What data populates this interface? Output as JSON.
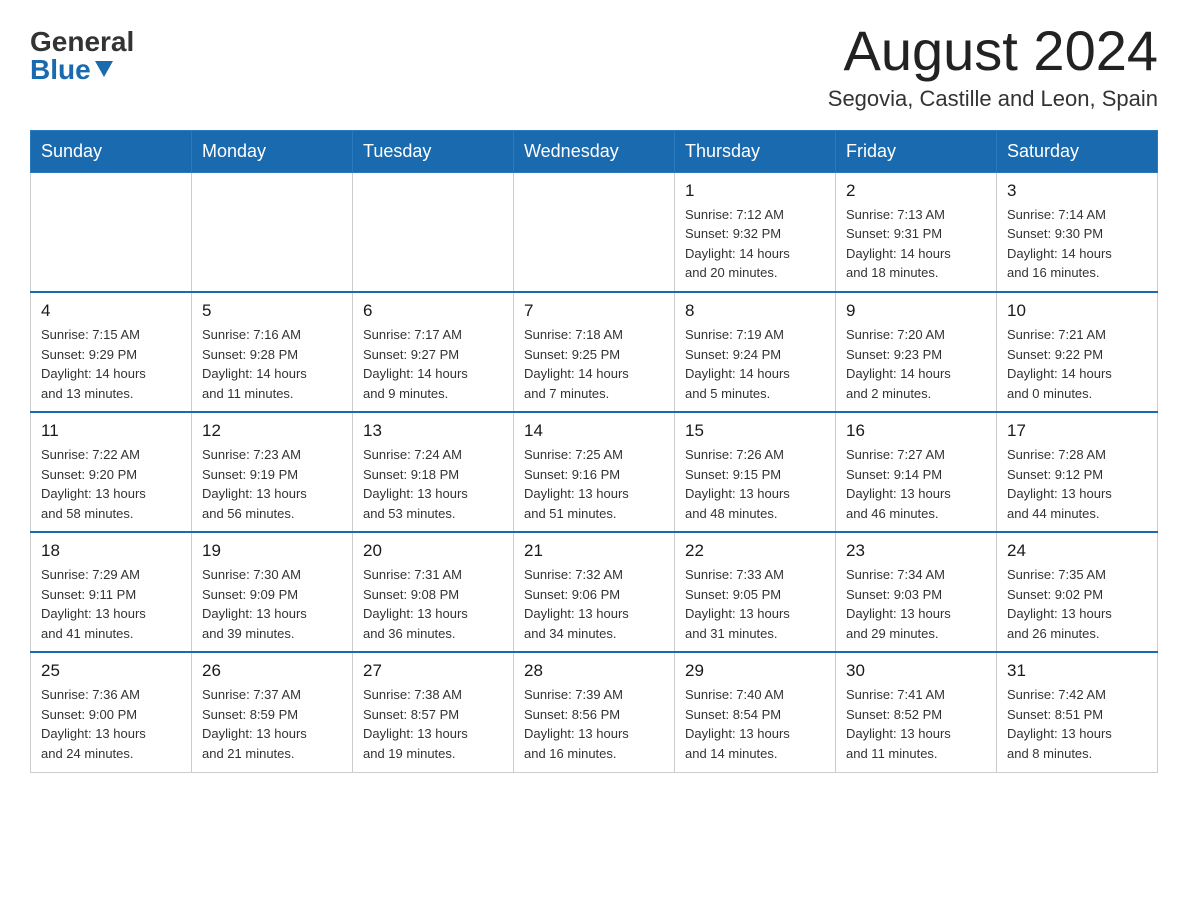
{
  "logo": {
    "general": "General",
    "blue": "Blue"
  },
  "title": {
    "month": "August 2024",
    "location": "Segovia, Castille and Leon, Spain"
  },
  "weekdays": [
    "Sunday",
    "Monday",
    "Tuesday",
    "Wednesday",
    "Thursday",
    "Friday",
    "Saturday"
  ],
  "weeks": [
    [
      {
        "day": "",
        "info": ""
      },
      {
        "day": "",
        "info": ""
      },
      {
        "day": "",
        "info": ""
      },
      {
        "day": "",
        "info": ""
      },
      {
        "day": "1",
        "info": "Sunrise: 7:12 AM\nSunset: 9:32 PM\nDaylight: 14 hours\nand 20 minutes."
      },
      {
        "day": "2",
        "info": "Sunrise: 7:13 AM\nSunset: 9:31 PM\nDaylight: 14 hours\nand 18 minutes."
      },
      {
        "day": "3",
        "info": "Sunrise: 7:14 AM\nSunset: 9:30 PM\nDaylight: 14 hours\nand 16 minutes."
      }
    ],
    [
      {
        "day": "4",
        "info": "Sunrise: 7:15 AM\nSunset: 9:29 PM\nDaylight: 14 hours\nand 13 minutes."
      },
      {
        "day": "5",
        "info": "Sunrise: 7:16 AM\nSunset: 9:28 PM\nDaylight: 14 hours\nand 11 minutes."
      },
      {
        "day": "6",
        "info": "Sunrise: 7:17 AM\nSunset: 9:27 PM\nDaylight: 14 hours\nand 9 minutes."
      },
      {
        "day": "7",
        "info": "Sunrise: 7:18 AM\nSunset: 9:25 PM\nDaylight: 14 hours\nand 7 minutes."
      },
      {
        "day": "8",
        "info": "Sunrise: 7:19 AM\nSunset: 9:24 PM\nDaylight: 14 hours\nand 5 minutes."
      },
      {
        "day": "9",
        "info": "Sunrise: 7:20 AM\nSunset: 9:23 PM\nDaylight: 14 hours\nand 2 minutes."
      },
      {
        "day": "10",
        "info": "Sunrise: 7:21 AM\nSunset: 9:22 PM\nDaylight: 14 hours\nand 0 minutes."
      }
    ],
    [
      {
        "day": "11",
        "info": "Sunrise: 7:22 AM\nSunset: 9:20 PM\nDaylight: 13 hours\nand 58 minutes."
      },
      {
        "day": "12",
        "info": "Sunrise: 7:23 AM\nSunset: 9:19 PM\nDaylight: 13 hours\nand 56 minutes."
      },
      {
        "day": "13",
        "info": "Sunrise: 7:24 AM\nSunset: 9:18 PM\nDaylight: 13 hours\nand 53 minutes."
      },
      {
        "day": "14",
        "info": "Sunrise: 7:25 AM\nSunset: 9:16 PM\nDaylight: 13 hours\nand 51 minutes."
      },
      {
        "day": "15",
        "info": "Sunrise: 7:26 AM\nSunset: 9:15 PM\nDaylight: 13 hours\nand 48 minutes."
      },
      {
        "day": "16",
        "info": "Sunrise: 7:27 AM\nSunset: 9:14 PM\nDaylight: 13 hours\nand 46 minutes."
      },
      {
        "day": "17",
        "info": "Sunrise: 7:28 AM\nSunset: 9:12 PM\nDaylight: 13 hours\nand 44 minutes."
      }
    ],
    [
      {
        "day": "18",
        "info": "Sunrise: 7:29 AM\nSunset: 9:11 PM\nDaylight: 13 hours\nand 41 minutes."
      },
      {
        "day": "19",
        "info": "Sunrise: 7:30 AM\nSunset: 9:09 PM\nDaylight: 13 hours\nand 39 minutes."
      },
      {
        "day": "20",
        "info": "Sunrise: 7:31 AM\nSunset: 9:08 PM\nDaylight: 13 hours\nand 36 minutes."
      },
      {
        "day": "21",
        "info": "Sunrise: 7:32 AM\nSunset: 9:06 PM\nDaylight: 13 hours\nand 34 minutes."
      },
      {
        "day": "22",
        "info": "Sunrise: 7:33 AM\nSunset: 9:05 PM\nDaylight: 13 hours\nand 31 minutes."
      },
      {
        "day": "23",
        "info": "Sunrise: 7:34 AM\nSunset: 9:03 PM\nDaylight: 13 hours\nand 29 minutes."
      },
      {
        "day": "24",
        "info": "Sunrise: 7:35 AM\nSunset: 9:02 PM\nDaylight: 13 hours\nand 26 minutes."
      }
    ],
    [
      {
        "day": "25",
        "info": "Sunrise: 7:36 AM\nSunset: 9:00 PM\nDaylight: 13 hours\nand 24 minutes."
      },
      {
        "day": "26",
        "info": "Sunrise: 7:37 AM\nSunset: 8:59 PM\nDaylight: 13 hours\nand 21 minutes."
      },
      {
        "day": "27",
        "info": "Sunrise: 7:38 AM\nSunset: 8:57 PM\nDaylight: 13 hours\nand 19 minutes."
      },
      {
        "day": "28",
        "info": "Sunrise: 7:39 AM\nSunset: 8:56 PM\nDaylight: 13 hours\nand 16 minutes."
      },
      {
        "day": "29",
        "info": "Sunrise: 7:40 AM\nSunset: 8:54 PM\nDaylight: 13 hours\nand 14 minutes."
      },
      {
        "day": "30",
        "info": "Sunrise: 7:41 AM\nSunset: 8:52 PM\nDaylight: 13 hours\nand 11 minutes."
      },
      {
        "day": "31",
        "info": "Sunrise: 7:42 AM\nSunset: 8:51 PM\nDaylight: 13 hours\nand 8 minutes."
      }
    ]
  ]
}
